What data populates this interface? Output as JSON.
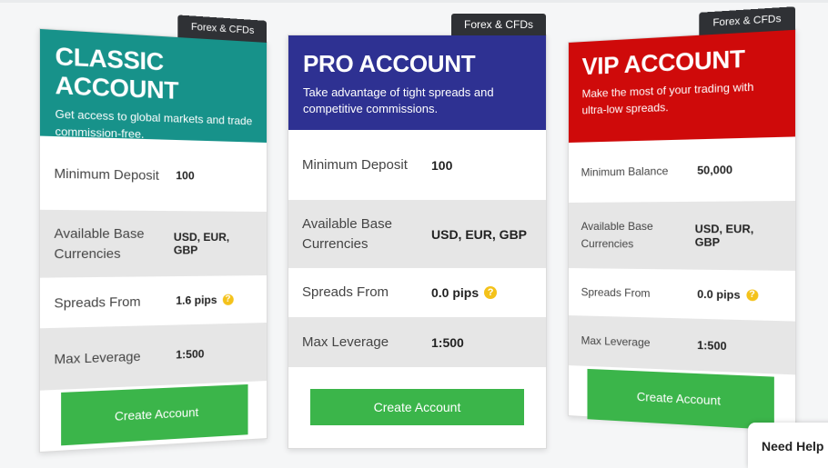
{
  "cards": {
    "classic": {
      "ribbon": "Forex & CFDs",
      "title": "CLASSIC ACCOUNT",
      "subtitle": "Get access to global markets and trade commission-free.",
      "rows": [
        {
          "label": "Minimum Deposit",
          "value": "100"
        },
        {
          "label": "Available Base Currencies",
          "value": "USD, EUR, GBP"
        },
        {
          "label": "Spreads From",
          "value": "1.6 pips"
        },
        {
          "label": "Max Leverage",
          "value": "1:500"
        }
      ],
      "button": "Create Account"
    },
    "pro": {
      "ribbon": "Forex & CFDs",
      "title": "PRO ACCOUNT",
      "subtitle": "Take advantage of tight spreads and competitive commissions.",
      "rows": [
        {
          "label": "Minimum Deposit",
          "value": "100"
        },
        {
          "label": "Available Base Currencies",
          "value": "USD, EUR, GBP"
        },
        {
          "label": "Spreads From",
          "value": "0.0 pips"
        },
        {
          "label": "Max Leverage",
          "value": "1:500"
        }
      ],
      "button": "Create Account"
    },
    "vip": {
      "ribbon": "Forex & CFDs",
      "title": "VIP ACCOUNT",
      "subtitle": "Make the most of your trading with ultra-low spreads.",
      "rows": [
        {
          "label": "Minimum Balance",
          "value": "50,000"
        },
        {
          "label": "Available Base Currencies",
          "value": "USD, EUR, GBP"
        },
        {
          "label": "Spreads From",
          "value": "0.0 pips"
        },
        {
          "label": "Max Leverage",
          "value": "1:500"
        }
      ],
      "button": "Create Account"
    }
  },
  "help_glyph": "?",
  "need_help": "Need Help",
  "colors": {
    "classic": "#17928a",
    "pro": "#2e3192",
    "vip": "#cf0a0a",
    "button": "#3bb54a",
    "ribbon": "#2f3135",
    "help_icon": "#f4c21a"
  }
}
